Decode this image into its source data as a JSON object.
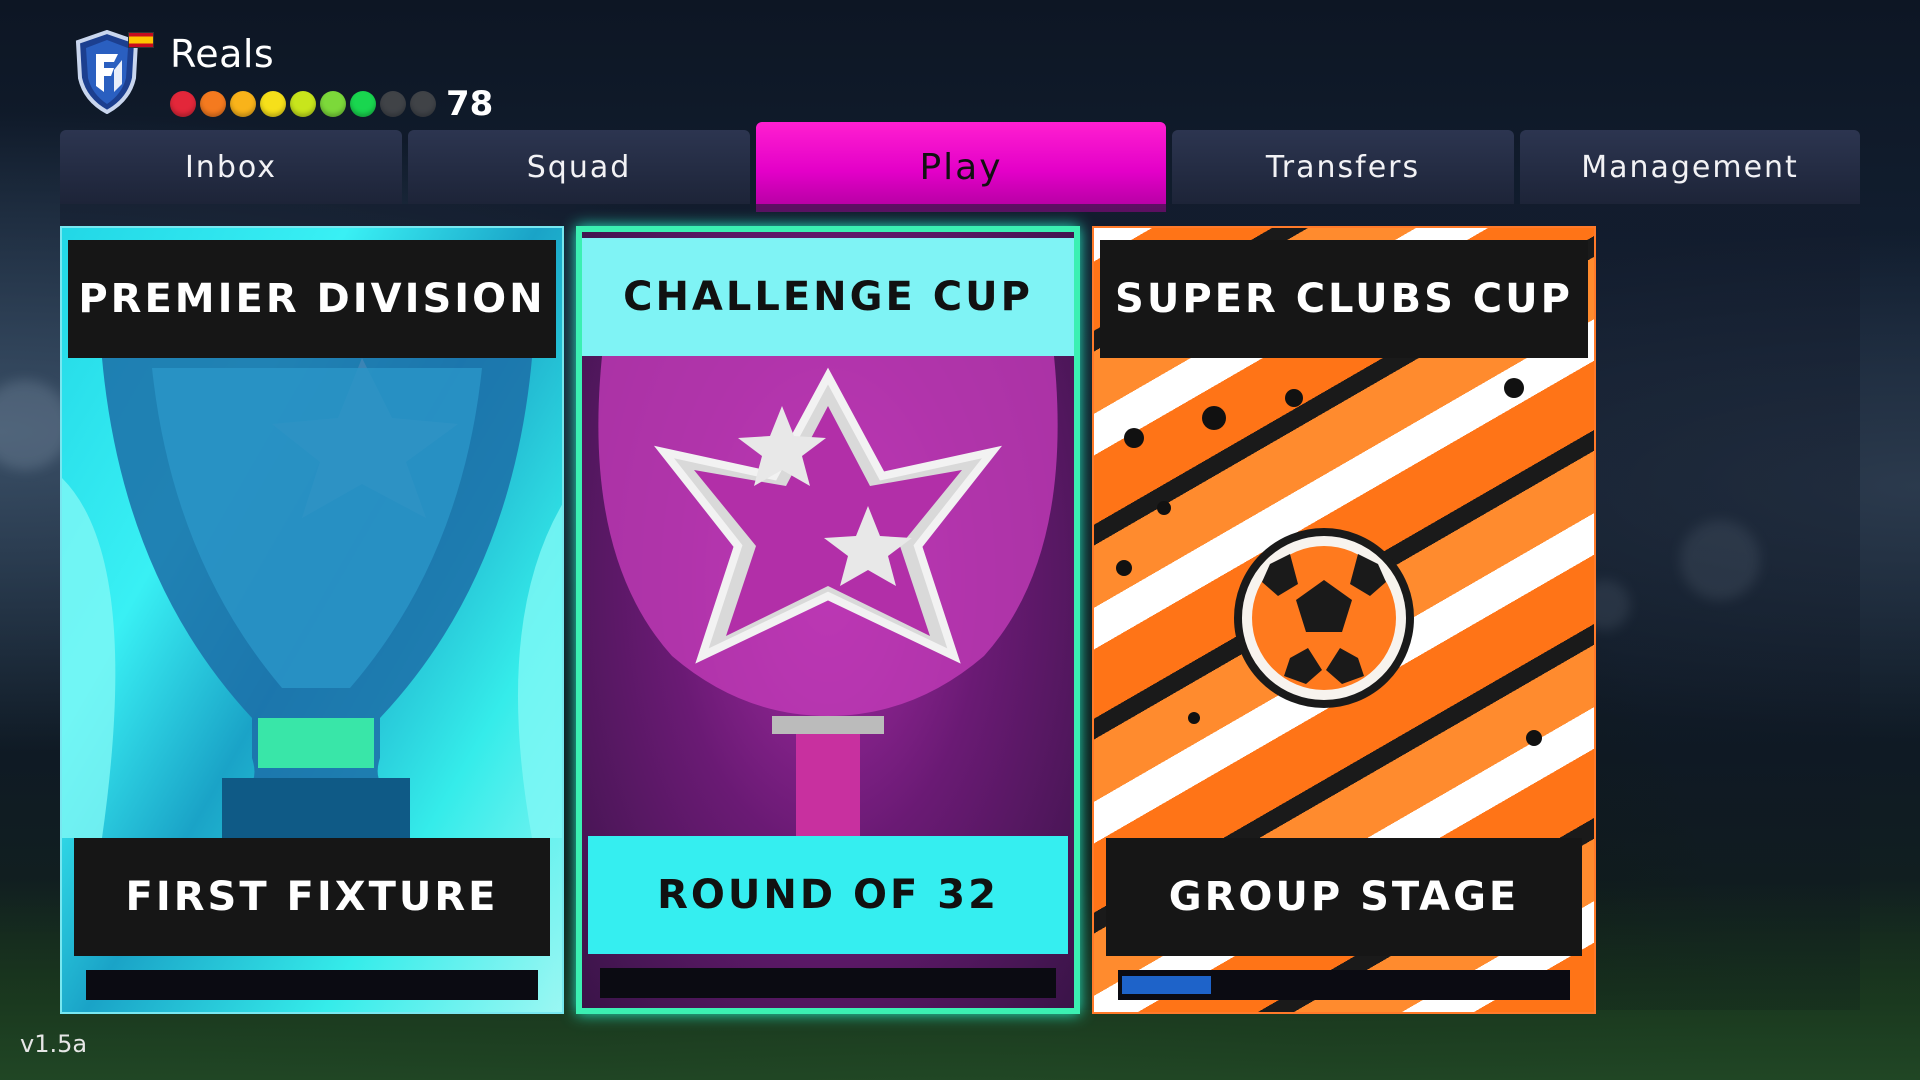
{
  "club": {
    "name": "Reals",
    "flag_icon": "spain-flag-icon",
    "crest_icon": "club-crest-icon",
    "rating": "78",
    "rating_dots": [
      {
        "color": "#e3273a",
        "filled": true
      },
      {
        "color": "#f47a1f",
        "filled": true
      },
      {
        "color": "#f9b31a",
        "filled": true
      },
      {
        "color": "#f6e01a",
        "filled": true
      },
      {
        "color": "#c8e51c",
        "filled": true
      },
      {
        "color": "#7cd93a",
        "filled": true
      },
      {
        "color": "#19d64f",
        "filled": true
      },
      {
        "color": "#555555",
        "filled": false
      },
      {
        "color": "#555555",
        "filled": false
      }
    ]
  },
  "tabs": [
    {
      "label": "Inbox",
      "active": false
    },
    {
      "label": "Squad",
      "active": false
    },
    {
      "label": "Play",
      "active": true
    },
    {
      "label": "Transfers",
      "active": false
    },
    {
      "label": "Management",
      "active": false
    }
  ],
  "competitions": [
    {
      "title": "PREMIER DIVISION",
      "status": "FIRST FIXTURE",
      "progress": 0,
      "art_icon": "cyan-trophy-icon"
    },
    {
      "title": "CHALLENGE CUP",
      "status": "ROUND OF 32",
      "progress": 0,
      "art_icon": "pink-star-trophy-icon"
    },
    {
      "title": "SUPER CLUBS CUP",
      "status": "GROUP STAGE",
      "progress": 0.2,
      "art_icon": "football-icon"
    }
  ],
  "version": "v1.5a",
  "colors": {
    "accent_tab": "#e300c8",
    "tab_bg": "#1d2438",
    "progress_fill": "#1e63c9",
    "challenge_border": "#3bf0b2"
  }
}
